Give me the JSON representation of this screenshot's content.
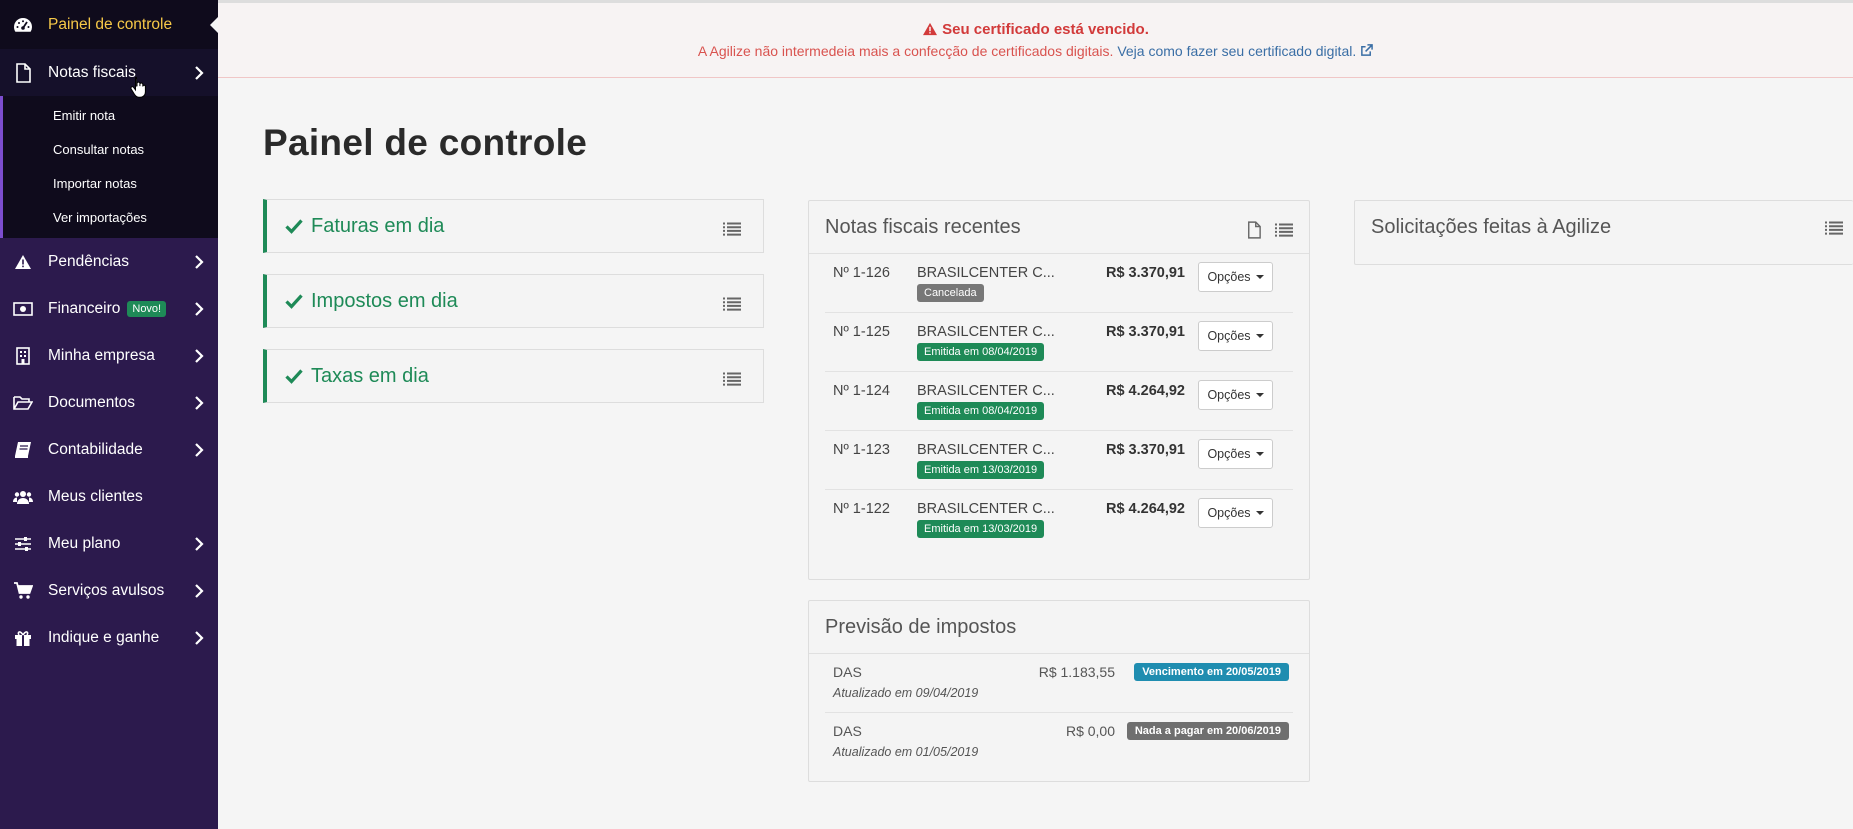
{
  "sidebar": {
    "items": [
      {
        "label": "Painel de controle",
        "icon": "dashboard-icon"
      },
      {
        "label": "Notas fiscais",
        "icon": "file-icon"
      },
      {
        "label": "Pendências",
        "icon": "warning-icon"
      },
      {
        "label": "Financeiro",
        "icon": "money-icon",
        "badge": "Novo!"
      },
      {
        "label": "Minha empresa",
        "icon": "building-icon"
      },
      {
        "label": "Documentos",
        "icon": "folder-open-icon"
      },
      {
        "label": "Contabilidade",
        "icon": "book-icon"
      },
      {
        "label": "Meus clientes",
        "icon": "users-icon"
      },
      {
        "label": "Meu plano",
        "icon": "sliders-icon"
      },
      {
        "label": "Serviços avulsos",
        "icon": "cart-icon"
      },
      {
        "label": "Indique e ganhe",
        "icon": "gift-icon"
      }
    ],
    "submenu": [
      "Emitir nota",
      "Consultar notas",
      "Importar notas",
      "Ver importações"
    ]
  },
  "alert": {
    "title": "Seu certificado está vencido.",
    "message": "A Agilize não intermedeia mais a confecção de certificados digitais.",
    "link": "Veja como fazer seu certificado digital."
  },
  "page_title": "Painel de controle",
  "status_cards": [
    "Faturas em dia",
    "Impostos em dia",
    "Taxas em dia"
  ],
  "notas": {
    "title": "Notas fiscais recentes",
    "options_label": "Opções",
    "rows": [
      {
        "num": "Nº 1-126",
        "client": "BRASILCENTER C...",
        "value": "R$ 3.370,91",
        "status": "Cancelada"
      },
      {
        "num": "Nº 1-125",
        "client": "BRASILCENTER C...",
        "value": "R$ 3.370,91",
        "status": "Emitida em 08/04/2019"
      },
      {
        "num": "Nº 1-124",
        "client": "BRASILCENTER C...",
        "value": "R$ 4.264,92",
        "status": "Emitida em 08/04/2019"
      },
      {
        "num": "Nº 1-123",
        "client": "BRASILCENTER C...",
        "value": "R$ 3.370,91",
        "status": "Emitida em 13/03/2019"
      },
      {
        "num": "Nº 1-122",
        "client": "BRASILCENTER C...",
        "value": "R$ 4.264,92",
        "status": "Emitida em 13/03/2019"
      }
    ]
  },
  "impostos": {
    "title": "Previsão de impostos",
    "rows": [
      {
        "name": "DAS",
        "updated": "Atualizado em 09/04/2019",
        "value": "R$ 1.183,55",
        "status": "Vencimento em 20/05/2019"
      },
      {
        "name": "DAS",
        "updated": "Atualizado em 01/05/2019",
        "value": "R$ 0,00",
        "status": "Nada a pagar em 20/06/2019"
      }
    ]
  },
  "solicitacoes": {
    "title": "Solicitações feitas à Agilize"
  },
  "colors": {
    "sidebar": "#2c1a4d",
    "active_text": "#f7c948",
    "success": "#1e8a57",
    "danger": "#d23a3a",
    "info": "#1f8db0"
  }
}
